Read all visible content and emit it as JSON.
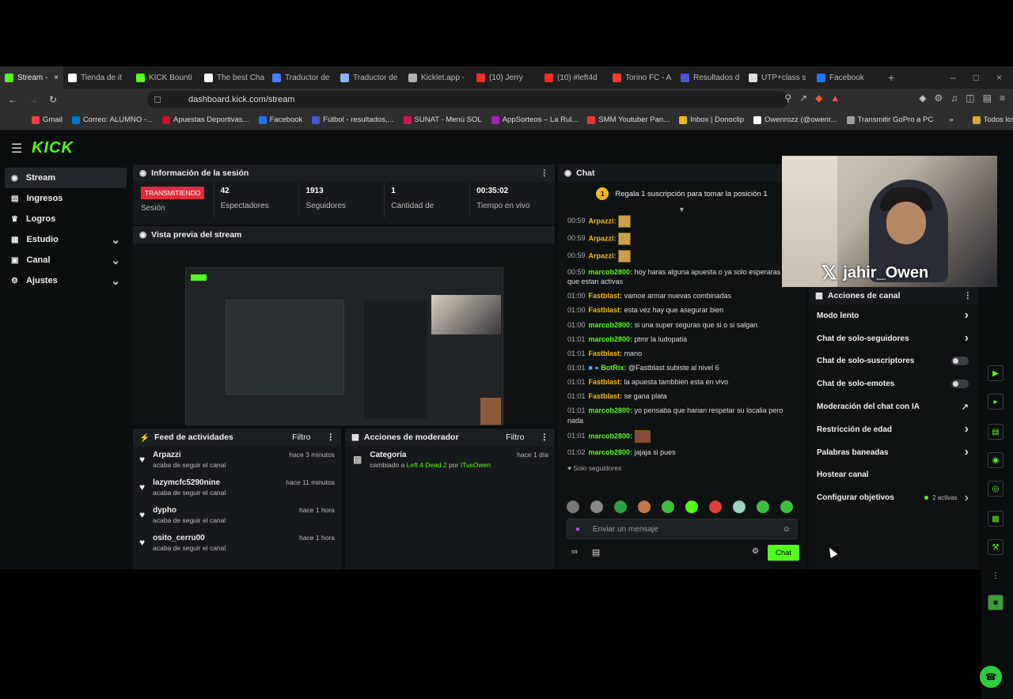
{
  "browser": {
    "tabs": [
      {
        "label": "Stream -",
        "color": "#53fc18",
        "active": true
      },
      {
        "label": "Tienda de it",
        "color": "#ffffff"
      },
      {
        "label": "KICK Bounti",
        "color": "#53fc18"
      },
      {
        "label": "The best Cha",
        "color": "#ffffff"
      },
      {
        "label": "Traductor de",
        "color": "#4a7df7"
      },
      {
        "label": "Traductor de",
        "color": "#8ab4f8"
      },
      {
        "label": "Kicklet.app -",
        "color": "#b0b0b0"
      },
      {
        "label": "(10) Jerry",
        "color": "#ff2a2a"
      },
      {
        "label": "(10) #left4d",
        "color": "#ff2a2a"
      },
      {
        "label": "Torino FC - A",
        "color": "#ff3b30"
      },
      {
        "label": "Resultados d",
        "color": "#4a55d4"
      },
      {
        "label": "UTP+class s",
        "color": "#dddddd"
      },
      {
        "label": "Facebook",
        "color": "#1877f2"
      }
    ],
    "url": "dashboard.kick.com/stream",
    "bookmarks": [
      {
        "label": "Gmail",
        "color": "#ea4335"
      },
      {
        "label": "Correo: ALUMNO -...",
        "color": "#0078d4"
      },
      {
        "label": "Apuestas Deportivas...",
        "color": "#c8102e"
      },
      {
        "label": "Facebook",
        "color": "#1877f2"
      },
      {
        "label": "Fútbol - resultados,...",
        "color": "#4a55d4"
      },
      {
        "label": "SUNAT - Menú SOL",
        "color": "#d4145a"
      },
      {
        "label": "AppSorteos – La Rul...",
        "color": "#9c27b0"
      },
      {
        "label": "SMM Youtuber Pan...",
        "color": "#e53935"
      },
      {
        "label": "Inbox | Donoclip",
        "color": "#f2b81c"
      },
      {
        "label": "Owenrozz (@owenr...",
        "color": "#ffffff"
      },
      {
        "label": "Transmitir GoPro a PC",
        "color": "#9e9e9e"
      }
    ],
    "all_bookmarks": "Todos los marcadores"
  },
  "sidebar": {
    "logo": "KICK",
    "items": [
      {
        "label": "Stream",
        "icon": "stream-icon"
      },
      {
        "label": "Ingresos",
        "icon": "wallet-icon"
      },
      {
        "label": "Logros",
        "icon": "trophy-icon"
      },
      {
        "label": "Estudio",
        "icon": "layers-icon"
      },
      {
        "label": "Canal",
        "icon": "channel-icon"
      },
      {
        "label": "Ajustes",
        "icon": "gear-icon"
      }
    ]
  },
  "session": {
    "title": "Información de la sesión",
    "badge": "TRANSMITIENDO",
    "badge_label": "Sesión",
    "stats": [
      {
        "value": "42",
        "label": "Espectadores"
      },
      {
        "value": "1913",
        "label": "Seguidores"
      },
      {
        "value": "1",
        "label": "Cantidad de"
      },
      {
        "value": "00:35:02",
        "label": "Tiempo en vivo"
      }
    ]
  },
  "preview": {
    "title": "Vista previa del stream"
  },
  "feed": {
    "title": "Feed de actividades",
    "filter": "Filtro",
    "items": [
      {
        "name": "Arpazzi",
        "sub": "acaba de seguir el canal",
        "time": "hace 3 minutos"
      },
      {
        "name": "lazymcfc5290nine",
        "sub": "acaba de seguir el canal",
        "time": "hace 11 minutos"
      },
      {
        "name": "dypho",
        "sub": "acaba de seguir el canal",
        "time": "hace 1 hora"
      },
      {
        "name": "osito_cerru00",
        "sub": "acaba de seguir el canal",
        "time": "hace 1 hora"
      }
    ]
  },
  "mod": {
    "title": "Acciones de moderador",
    "filter": "Filtro",
    "item": {
      "label": "Categoría",
      "time": "hace 1 día",
      "pre": "cambiado a ",
      "game": "Left 4 Dead 2",
      "mid": " por ",
      "user": "ITusOwen"
    }
  },
  "chat": {
    "title": "Chat",
    "pinned": "Regala 1 suscripción para tomar la posición 1",
    "pinned_num": "1",
    "messages": [
      {
        "time": "00:59",
        "user": "Arpazzi:",
        "color": "#f2b81c",
        "text": "",
        "emote": true
      },
      {
        "time": "00:59",
        "user": "Arpazzi:",
        "color": "#f2b81c",
        "text": "",
        "emote": true
      },
      {
        "time": "00:59",
        "user": "Arpazzi:",
        "color": "#f2b81c",
        "text": "",
        "emote": true
      },
      {
        "time": "00:59",
        "user": "marcob2800:",
        "color": "#53fc18",
        "text": "hoy haras alguna apuesta o ya solo esperaras las que estan activas"
      },
      {
        "time": "01:00",
        "user": "Fastblast:",
        "color": "#f2b81c",
        "text": "vamoe armar nuevas combinadas"
      },
      {
        "time": "01:00",
        "user": "Fastblast:",
        "color": "#f2b81c",
        "text": "esta vez hay que asegurar bien"
      },
      {
        "time": "01:00",
        "user": "marcob2800:",
        "color": "#53fc18",
        "text": "si una super seguras que si o si salgan"
      },
      {
        "time": "01:01",
        "user": "marcob2800:",
        "color": "#53fc18",
        "text": "ptmr la ludopatia"
      },
      {
        "time": "01:01",
        "user": "Fastblast:",
        "color": "#f2b81c",
        "text": "mano"
      },
      {
        "time": "01:01",
        "user": "BotRix:",
        "color": "#53fc18",
        "text": "@Fastblast subiste al nivel 6"
      },
      {
        "time": "01:01",
        "user": "Fastblast:",
        "color": "#f2b81c",
        "text": "la apuesta tambbien esta en vivo"
      },
      {
        "time": "01:01",
        "user": "Fastblast:",
        "color": "#f2b81c",
        "text": "se gana plata"
      },
      {
        "time": "01:01",
        "user": "marcob2800:",
        "color": "#53fc18",
        "text": "yo pensaba que harian respetar su localia pero nada"
      },
      {
        "time": "01:01",
        "user": "marcob2800:",
        "color": "#53fc18",
        "text": "",
        "emote": true
      },
      {
        "time": "01:02",
        "user": "marcob2800:",
        "color": "#53fc18",
        "text": "jajaja si pues"
      }
    ],
    "mode": "Solo seguidores",
    "placeholder": "Enviar un mensaje",
    "send": "Chat"
  },
  "overlay": {
    "name": "jahir_Owen"
  },
  "channel_actions": {
    "title": "Acciones de canal",
    "items": [
      {
        "label": "Modo lento",
        "type": "arrow"
      },
      {
        "label": "Chat de solo-seguidores",
        "type": "arrow"
      },
      {
        "label": "Chat de solo-suscriptores",
        "type": "toggle"
      },
      {
        "label": "Chat de solo-emotes",
        "type": "toggle"
      },
      {
        "label": "Moderación del chat con IA",
        "type": "external"
      },
      {
        "label": "Restricción de edad",
        "type": "arrow"
      },
      {
        "label": "Palabras baneadas",
        "type": "arrow"
      },
      {
        "label": "Hostear canal",
        "type": "none"
      },
      {
        "label": "Configurar objetivos",
        "type": "active",
        "extra": "2 activas"
      }
    ]
  }
}
